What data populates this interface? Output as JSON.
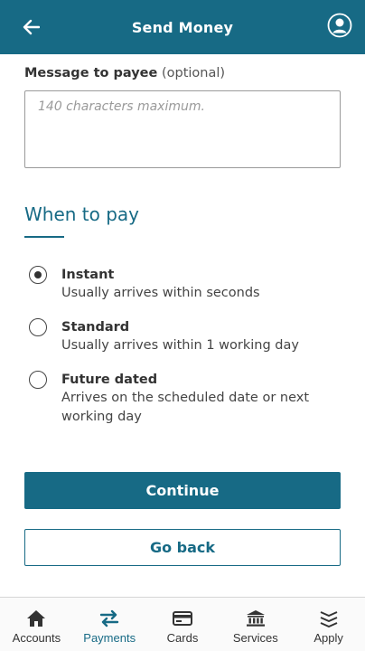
{
  "header": {
    "title": "Send Money"
  },
  "message": {
    "label": "Message to payee",
    "optional": "(optional)",
    "placeholder": "140 characters maximum.",
    "value": ""
  },
  "when_to_pay": {
    "title": "When to pay",
    "selected": "instant",
    "options": [
      {
        "id": "instant",
        "title": "Instant",
        "desc": "Usually arrives within seconds"
      },
      {
        "id": "standard",
        "title": "Standard",
        "desc": "Usually arrives within 1 working day"
      },
      {
        "id": "future",
        "title": "Future dated",
        "desc": "Arrives on the scheduled date or next working day"
      }
    ]
  },
  "actions": {
    "continue_label": "Continue",
    "back_label": "Go back"
  },
  "tabbar": {
    "active": "payments",
    "items": [
      {
        "id": "accounts",
        "label": "Accounts",
        "icon": "home-icon"
      },
      {
        "id": "payments",
        "label": "Payments",
        "icon": "transfer-arrows-icon"
      },
      {
        "id": "cards",
        "label": "Cards",
        "icon": "card-icon"
      },
      {
        "id": "services",
        "label": "Services",
        "icon": "bank-icon"
      },
      {
        "id": "apply",
        "label": "Apply",
        "icon": "layers-icon"
      }
    ]
  },
  "colors": {
    "brand": "#176a85",
    "text": "#333333"
  }
}
